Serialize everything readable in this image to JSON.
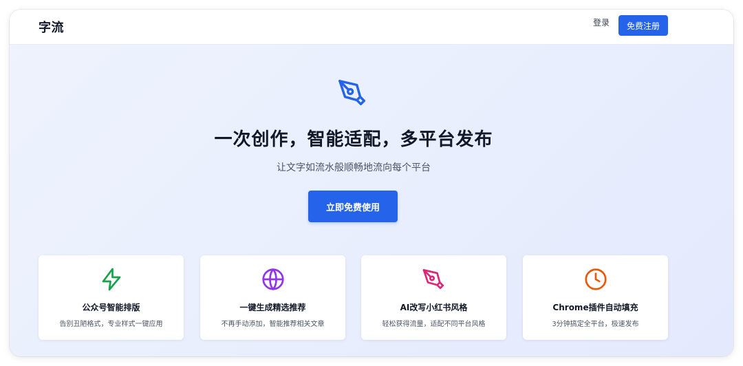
{
  "header": {
    "logo": "字流",
    "login_label": "登录",
    "signup_label": "免费注册"
  },
  "hero": {
    "icon": "pen-nib-icon",
    "title": "一次创作，智能适配，多平台发布",
    "subtitle": "让文字如流水般顺畅地流向每个平台",
    "cta_label": "立即免费使用"
  },
  "features": [
    {
      "icon": "lightning-icon",
      "title": "公众号智能排版",
      "desc": "告别丑陋格式，专业样式一键应用",
      "color": "#16a34a"
    },
    {
      "icon": "globe-icon",
      "title": "一键生成精选推荐",
      "desc": "不再手动添加，智能推荐相关文章",
      "color": "#9333ea"
    },
    {
      "icon": "pen-nib-icon",
      "title": "AI改写小红书风格",
      "desc": "轻松获得流量，适配不同平台风格",
      "color": "#db2777"
    },
    {
      "icon": "clock-icon",
      "title": "Chrome插件自动填充",
      "desc": "3分钟搞定全平台，极速发布",
      "color": "#ea580c"
    }
  ],
  "colors": {
    "accent": "#2563eb",
    "hero_icon": "#2563eb"
  }
}
